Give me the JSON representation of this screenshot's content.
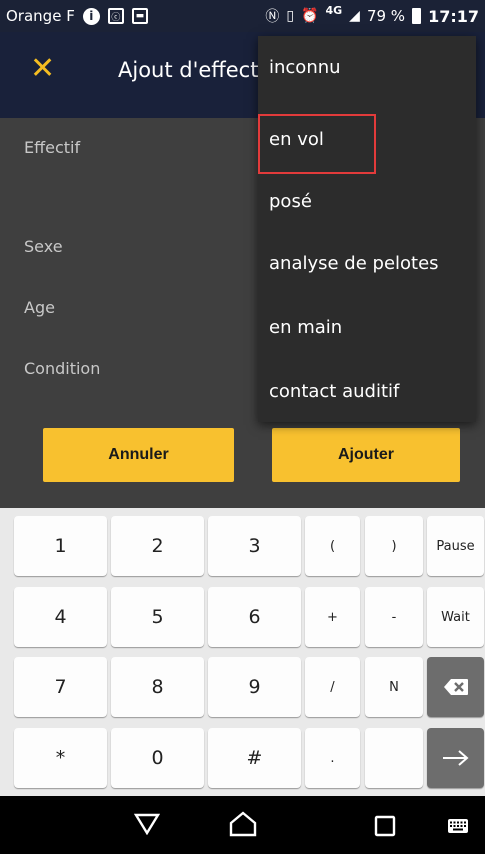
{
  "status_bar": {
    "carrier": "Orange F",
    "network": "4G",
    "battery": "79 %",
    "time": "17:17"
  },
  "app_bar": {
    "title": "Ajout d'effect"
  },
  "form": {
    "labels": [
      "Effectif",
      "Sexe",
      "Age",
      "Condition"
    ],
    "cancel_label": "Annuler",
    "add_label": "Ajouter"
  },
  "menu": {
    "items": [
      "inconnu",
      "en vol",
      "posé",
      "analyse de pelotes",
      "en main",
      "contact auditif"
    ],
    "highlighted_index": 1
  },
  "keypad": {
    "rows": [
      [
        "1",
        "2",
        "3",
        "(",
        ")",
        "Pause"
      ],
      [
        "4",
        "5",
        "6",
        "+",
        "-",
        "Wait"
      ],
      [
        "7",
        "8",
        "9",
        "/",
        "N",
        ""
      ],
      [
        "*",
        "0",
        "#",
        ".",
        "",
        ""
      ]
    ]
  },
  "colors": {
    "accent": "#f8c12f",
    "app_bar": "#19213a",
    "form_bg": "#3f3f3f",
    "menu_bg": "#2c2c2c",
    "highlight": "#e23b3b"
  }
}
